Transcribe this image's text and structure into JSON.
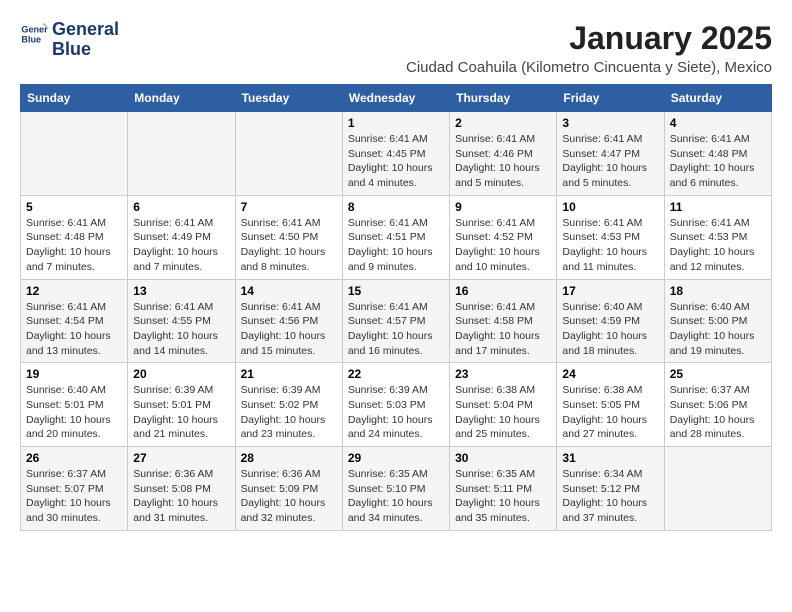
{
  "header": {
    "logo_line1": "General",
    "logo_line2": "Blue",
    "title": "January 2025",
    "subtitle": "Ciudad Coahuila (Kilometro Cincuenta y Siete), Mexico"
  },
  "days_of_week": [
    "Sunday",
    "Monday",
    "Tuesday",
    "Wednesday",
    "Thursday",
    "Friday",
    "Saturday"
  ],
  "weeks": [
    [
      {
        "day": "",
        "info": ""
      },
      {
        "day": "",
        "info": ""
      },
      {
        "day": "",
        "info": ""
      },
      {
        "day": "1",
        "info": "Sunrise: 6:41 AM\nSunset: 4:45 PM\nDaylight: 10 hours and 4 minutes."
      },
      {
        "day": "2",
        "info": "Sunrise: 6:41 AM\nSunset: 4:46 PM\nDaylight: 10 hours and 5 minutes."
      },
      {
        "day": "3",
        "info": "Sunrise: 6:41 AM\nSunset: 4:47 PM\nDaylight: 10 hours and 5 minutes."
      },
      {
        "day": "4",
        "info": "Sunrise: 6:41 AM\nSunset: 4:48 PM\nDaylight: 10 hours and 6 minutes."
      }
    ],
    [
      {
        "day": "5",
        "info": "Sunrise: 6:41 AM\nSunset: 4:48 PM\nDaylight: 10 hours and 7 minutes."
      },
      {
        "day": "6",
        "info": "Sunrise: 6:41 AM\nSunset: 4:49 PM\nDaylight: 10 hours and 7 minutes."
      },
      {
        "day": "7",
        "info": "Sunrise: 6:41 AM\nSunset: 4:50 PM\nDaylight: 10 hours and 8 minutes."
      },
      {
        "day": "8",
        "info": "Sunrise: 6:41 AM\nSunset: 4:51 PM\nDaylight: 10 hours and 9 minutes."
      },
      {
        "day": "9",
        "info": "Sunrise: 6:41 AM\nSunset: 4:52 PM\nDaylight: 10 hours and 10 minutes."
      },
      {
        "day": "10",
        "info": "Sunrise: 6:41 AM\nSunset: 4:53 PM\nDaylight: 10 hours and 11 minutes."
      },
      {
        "day": "11",
        "info": "Sunrise: 6:41 AM\nSunset: 4:53 PM\nDaylight: 10 hours and 12 minutes."
      }
    ],
    [
      {
        "day": "12",
        "info": "Sunrise: 6:41 AM\nSunset: 4:54 PM\nDaylight: 10 hours and 13 minutes."
      },
      {
        "day": "13",
        "info": "Sunrise: 6:41 AM\nSunset: 4:55 PM\nDaylight: 10 hours and 14 minutes."
      },
      {
        "day": "14",
        "info": "Sunrise: 6:41 AM\nSunset: 4:56 PM\nDaylight: 10 hours and 15 minutes."
      },
      {
        "day": "15",
        "info": "Sunrise: 6:41 AM\nSunset: 4:57 PM\nDaylight: 10 hours and 16 minutes."
      },
      {
        "day": "16",
        "info": "Sunrise: 6:41 AM\nSunset: 4:58 PM\nDaylight: 10 hours and 17 minutes."
      },
      {
        "day": "17",
        "info": "Sunrise: 6:40 AM\nSunset: 4:59 PM\nDaylight: 10 hours and 18 minutes."
      },
      {
        "day": "18",
        "info": "Sunrise: 6:40 AM\nSunset: 5:00 PM\nDaylight: 10 hours and 19 minutes."
      }
    ],
    [
      {
        "day": "19",
        "info": "Sunrise: 6:40 AM\nSunset: 5:01 PM\nDaylight: 10 hours and 20 minutes."
      },
      {
        "day": "20",
        "info": "Sunrise: 6:39 AM\nSunset: 5:01 PM\nDaylight: 10 hours and 21 minutes."
      },
      {
        "day": "21",
        "info": "Sunrise: 6:39 AM\nSunset: 5:02 PM\nDaylight: 10 hours and 23 minutes."
      },
      {
        "day": "22",
        "info": "Sunrise: 6:39 AM\nSunset: 5:03 PM\nDaylight: 10 hours and 24 minutes."
      },
      {
        "day": "23",
        "info": "Sunrise: 6:38 AM\nSunset: 5:04 PM\nDaylight: 10 hours and 25 minutes."
      },
      {
        "day": "24",
        "info": "Sunrise: 6:38 AM\nSunset: 5:05 PM\nDaylight: 10 hours and 27 minutes."
      },
      {
        "day": "25",
        "info": "Sunrise: 6:37 AM\nSunset: 5:06 PM\nDaylight: 10 hours and 28 minutes."
      }
    ],
    [
      {
        "day": "26",
        "info": "Sunrise: 6:37 AM\nSunset: 5:07 PM\nDaylight: 10 hours and 30 minutes."
      },
      {
        "day": "27",
        "info": "Sunrise: 6:36 AM\nSunset: 5:08 PM\nDaylight: 10 hours and 31 minutes."
      },
      {
        "day": "28",
        "info": "Sunrise: 6:36 AM\nSunset: 5:09 PM\nDaylight: 10 hours and 32 minutes."
      },
      {
        "day": "29",
        "info": "Sunrise: 6:35 AM\nSunset: 5:10 PM\nDaylight: 10 hours and 34 minutes."
      },
      {
        "day": "30",
        "info": "Sunrise: 6:35 AM\nSunset: 5:11 PM\nDaylight: 10 hours and 35 minutes."
      },
      {
        "day": "31",
        "info": "Sunrise: 6:34 AM\nSunset: 5:12 PM\nDaylight: 10 hours and 37 minutes."
      },
      {
        "day": "",
        "info": ""
      }
    ]
  ]
}
